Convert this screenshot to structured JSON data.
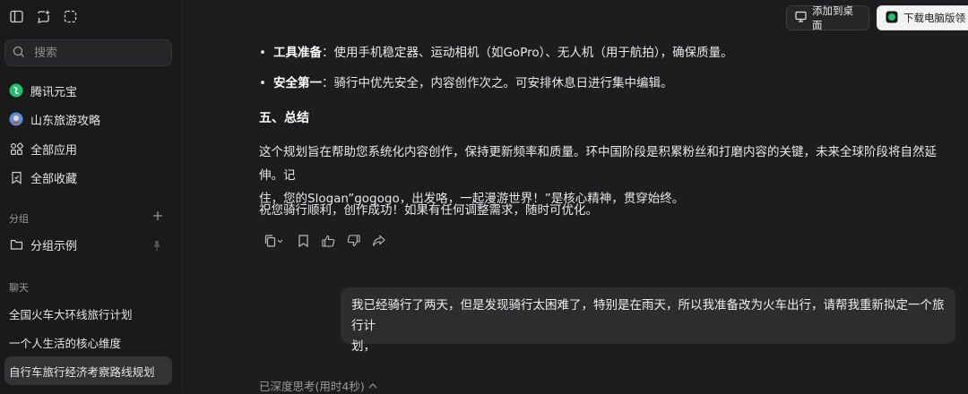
{
  "sidebar": {
    "search_placeholder": "搜索",
    "items": [
      {
        "label": "腾讯元宝"
      },
      {
        "label": "山东旅游攻略"
      },
      {
        "label": "全部应用"
      },
      {
        "label": "全部收藏"
      }
    ],
    "groups_label": "分组",
    "group_example": "分组示例",
    "chats_label": "聊天",
    "chats": [
      {
        "label": "全国火车大环线旅行计划"
      },
      {
        "label": "一个人生活的核心维度"
      },
      {
        "label": "自行车旅行经济考察路线规划"
      }
    ]
  },
  "header": {
    "add_to_desktop": "添加到桌面",
    "download_pc": "下载电脑版领视"
  },
  "message": {
    "bullet1_bold": "工具准备",
    "bullet1_text": "：使用手机稳定器、运动相机（如GoPro）、无人机（用于航拍），确保质量。",
    "bullet2_bold": "安全第一",
    "bullet2_text": "：骑行中优先安全，内容创作次之。可安排休息日进行集中编辑。",
    "heading": "五、总结",
    "para1_line1": "这个规划旨在帮助您系统化内容创作，保持更新频率和质量。环中国阶段是积累粉丝和打磨内容的关键，未来全球阶段将自然延伸。记",
    "para1_line2": "住，您的Slogan”gogogo，出发咯，一起漫游世界！”是核心精神，贯穿始终。",
    "para2": "祝您骑行顺利，创作成功！如果有任何调整需求，随时可优化。"
  },
  "user_message": {
    "line1": "我已经骑行了两天，但是发现骑行太困难了，特别是在雨天，所以我准备改为火车出行，请帮我重新拟定一个旅行计",
    "line2": "划，"
  },
  "thinking_status": "已深度思考(用时4秒)",
  "colors": {
    "background": "#1d1d1f",
    "sidebar": "#1a1a1b",
    "bubble": "#2d2d2f",
    "accent_green": "#1fc26a"
  }
}
